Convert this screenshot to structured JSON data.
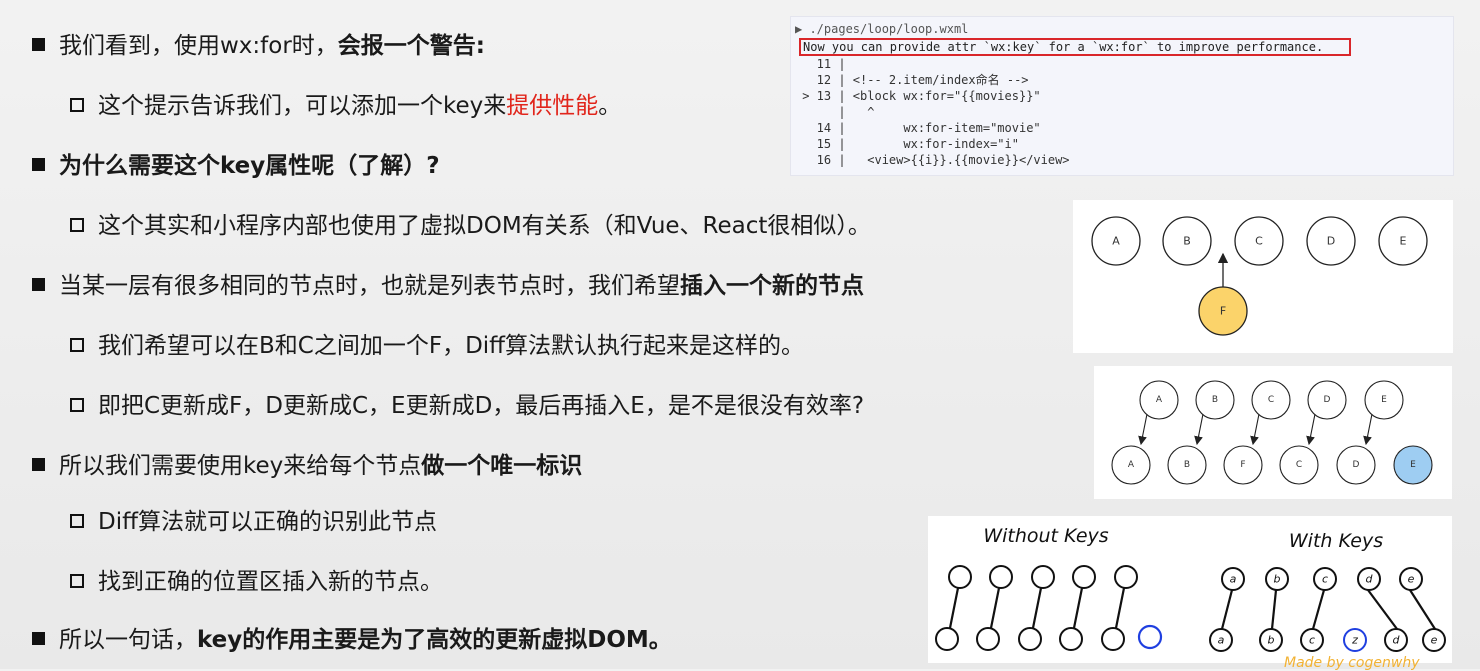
{
  "bullets": [
    {
      "level": 1,
      "parts": [
        {
          "t": "我们看到，使用wx:for时，",
          "s": ""
        },
        {
          "t": "会报一个警告:",
          "s": "em"
        }
      ]
    },
    {
      "level": 2,
      "parts": [
        {
          "t": "这个提示告诉我们，可以添加一个key来",
          "s": ""
        },
        {
          "t": "提供性能",
          "s": "red"
        },
        {
          "t": "。",
          "s": ""
        }
      ]
    },
    {
      "level": 1,
      "parts": [
        {
          "t": "为什么需要这个key属性呢（了解）?",
          "s": "em"
        }
      ]
    },
    {
      "level": 2,
      "parts": [
        {
          "t": "这个其实和小程序内部也使用了虚拟DOM有关系（和Vue、React很相似）。",
          "s": ""
        }
      ]
    },
    {
      "level": 1,
      "parts": [
        {
          "t": "当某一层有很多相同的节点时，也就是列表节点时，我们希望",
          "s": ""
        },
        {
          "t": "插入一个新的节点",
          "s": "em"
        }
      ]
    },
    {
      "level": 2,
      "parts": [
        {
          "t": "我们希望可以在B和C之间加一个F，Diff算法默认执行起来是这样的。",
          "s": ""
        }
      ]
    },
    {
      "level": 2,
      "parts": [
        {
          "t": "即把C更新成F，D更新成C，E更新成D，最后再插入E，是不是很没有效率?",
          "s": ""
        }
      ]
    },
    {
      "level": 1,
      "parts": [
        {
          "t": "所以我们需要使用key来给每个节点",
          "s": ""
        },
        {
          "t": "做一个唯一标识",
          "s": "em"
        }
      ]
    },
    {
      "level": 2,
      "parts": [
        {
          "t": "Diff算法就可以正确的识别此节点",
          "s": ""
        }
      ]
    },
    {
      "level": 2,
      "parts": [
        {
          "t": "找到正确的位置区插入新的节点。",
          "s": ""
        }
      ]
    },
    {
      "level": 1,
      "parts": [
        {
          "t": "所以一句话，",
          "s": ""
        },
        {
          "t": "key的作用主要是为了高效的更新虚拟DOM。",
          "s": "em"
        }
      ]
    }
  ],
  "code": {
    "path": "▶ ./pages/loop/loop.wxml",
    "warning": "Now you can provide attr `wx:key` for a `wx:for` to improve performance.",
    "lines": [
      "   11 |",
      "   12 | <!-- 2.item/index命名 -->",
      " > 13 | <block wx:for=\"{{movies}}\"",
      "      |   ^",
      "   14 |        wx:for-item=\"movie\"",
      "   15 |        wx:for-index=\"i\"",
      "   16 |   <view>{{i}}.{{movie}}</view>"
    ]
  },
  "diagram1": {
    "nodes": [
      "A",
      "B",
      "C",
      "D",
      "E"
    ],
    "new_node": "F",
    "new_node_color": "#fbd36a"
  },
  "diagram2": {
    "top": [
      "A",
      "B",
      "C",
      "D",
      "E"
    ],
    "bottom": [
      "A",
      "B",
      "F",
      "C",
      "D",
      "E"
    ],
    "highlight_color": "#9ecdf2"
  },
  "diagram3": {
    "left_title": "Without Keys",
    "right_title": "With Keys",
    "right_top": [
      "a",
      "b",
      "c",
      "d",
      "e"
    ],
    "right_bottom": [
      "a",
      "b",
      "c",
      "z",
      "d",
      "e"
    ],
    "new_color": "#1f3fe0"
  },
  "watermark": "Made by cogenwhy"
}
